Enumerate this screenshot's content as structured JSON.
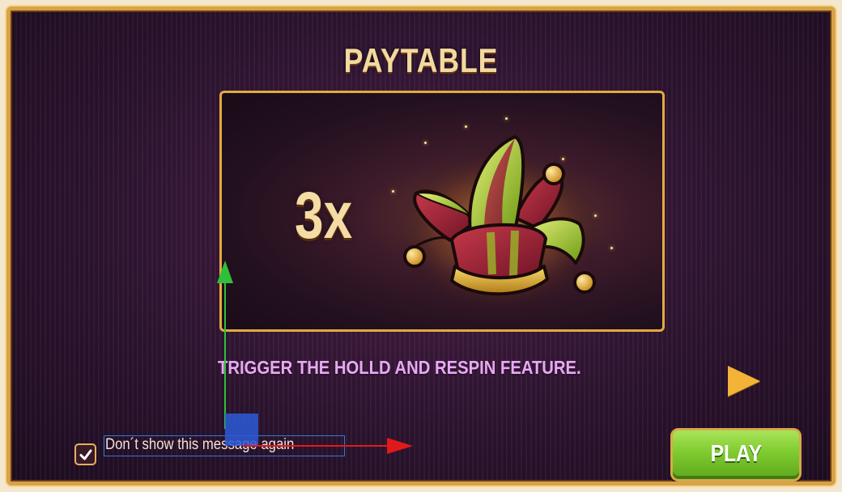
{
  "header": {
    "title": "PAYTABLE"
  },
  "symbol_panel": {
    "multiplier": "3x",
    "symbol_icon": "jester-hat-icon"
  },
  "feature_caption": "TRIGGER THE HOLLD AND RESPIN FEATURE.",
  "controls": {
    "next_icon": "chevron-right-icon",
    "dont_show_checked": true,
    "dont_show_label": "Don´t show this message again",
    "play_label": "PLAY"
  },
  "colors": {
    "background": "#2d1430",
    "frame_gold": "#d7a248",
    "title": "#f3d9a0",
    "caption": "#e7a9f2",
    "play_green": "#7fcb2f",
    "arrow_gold": "#f2b336"
  }
}
